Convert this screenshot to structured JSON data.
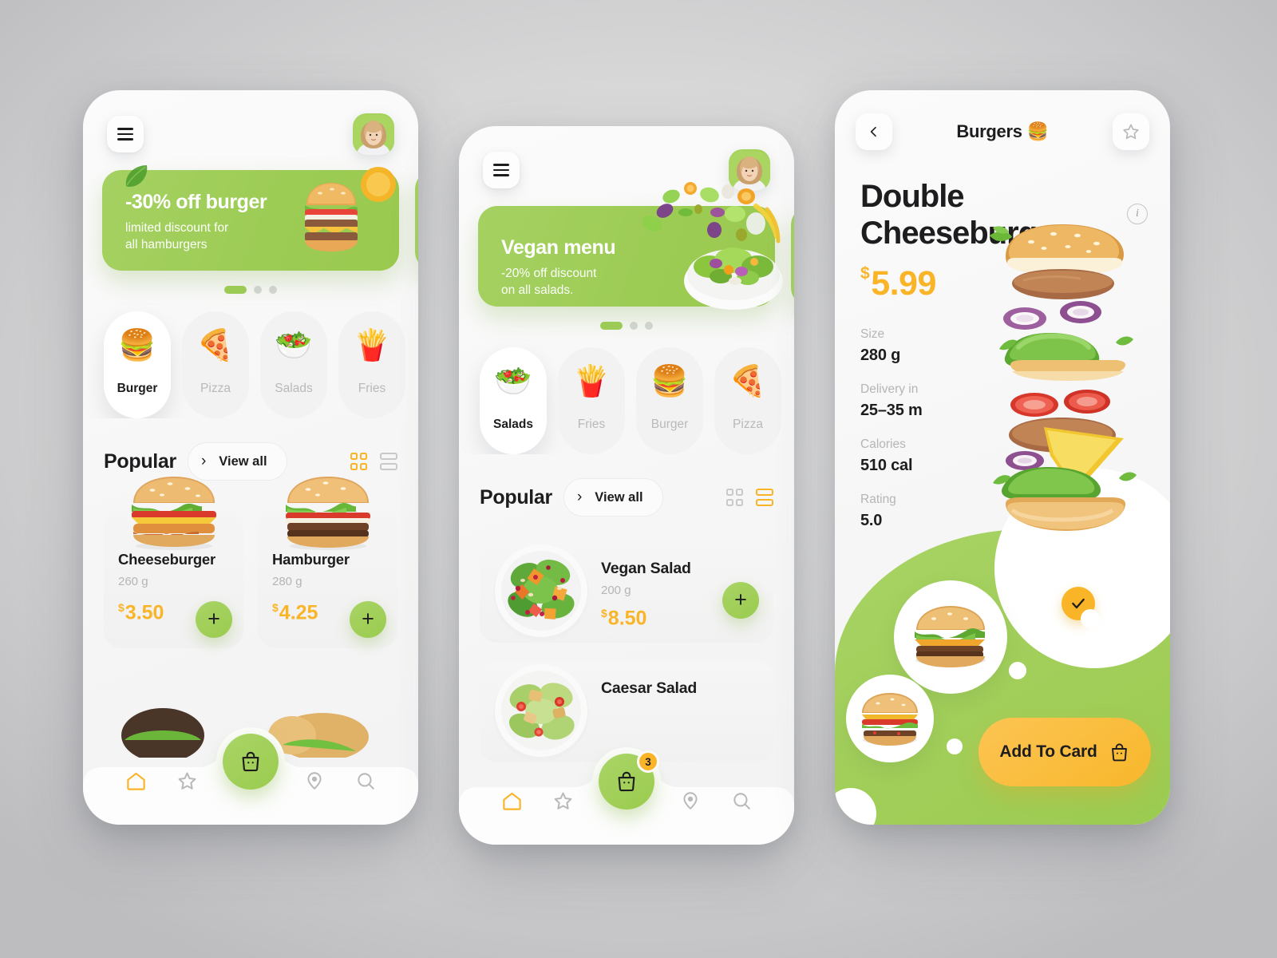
{
  "theme": {
    "green": "#9ACB51",
    "yellow": "#F9B428",
    "dark": "#1D1D1F",
    "muted": "#B5B5B7",
    "card_bg": "#F2F2F2"
  },
  "phone1": {
    "menu_icon": "hamburger-menu-icon",
    "avatar_alt": "user-avatar",
    "banner": {
      "title": "-30% off burger",
      "subtitle_line1": "limited discount for",
      "subtitle_line2": "all hamburgers",
      "art": "burger-photo"
    },
    "carousel": {
      "total": 3,
      "active": 1
    },
    "categories": [
      {
        "label": "Burger",
        "emoji": "🍔",
        "active": true
      },
      {
        "label": "Pizza",
        "emoji": "🍕",
        "active": false
      },
      {
        "label": "Salads",
        "emoji": "🥗",
        "active": false
      },
      {
        "label": "Fries",
        "emoji": "🍟",
        "active": false
      }
    ],
    "section": {
      "title": "Popular",
      "view_all": "View all",
      "chevron": "›",
      "grid_active": true,
      "list_active": false
    },
    "products": [
      {
        "name": "Cheeseburger",
        "weight": "260 g",
        "currency": "$",
        "price": "3.50",
        "add": "+"
      },
      {
        "name": "Hamburger",
        "weight": "280 g",
        "currency": "$",
        "price": "4.25",
        "add": "+"
      }
    ],
    "nav": {
      "items": [
        "home-icon",
        "star-icon",
        "location-pin-icon",
        "search-icon"
      ],
      "active": "home-icon",
      "cart_icon": "shopping-bag-icon",
      "cart_badge": ""
    }
  },
  "phone2": {
    "menu_icon": "hamburger-menu-icon",
    "avatar_alt": "user-avatar",
    "banner": {
      "title": "Vegan menu",
      "subtitle_line1": "-20% off discount",
      "subtitle_line2": "on all salads.",
      "art": "salad-photo"
    },
    "carousel": {
      "total": 3,
      "active": 1
    },
    "categories": [
      {
        "label": "Salads",
        "emoji": "🥗",
        "active": true
      },
      {
        "label": "Fries",
        "emoji": "🍟",
        "active": false
      },
      {
        "label": "Burger",
        "emoji": "🍔",
        "active": false
      },
      {
        "label": "Pizza",
        "emoji": "🍕",
        "active": false
      }
    ],
    "section": {
      "title": "Popular",
      "view_all": "View all",
      "chevron": "›",
      "grid_active": false,
      "list_active": true
    },
    "products": [
      {
        "name": "Vegan Salad",
        "weight": "200 g",
        "currency": "$",
        "price": "8.50",
        "add": "+"
      },
      {
        "name": "Caesar Salad",
        "weight": "",
        "currency": "",
        "price": "",
        "add": "+"
      }
    ],
    "nav": {
      "items": [
        "home-icon",
        "star-icon",
        "location-pin-icon",
        "search-icon"
      ],
      "active": "home-icon",
      "cart_icon": "shopping-bag-icon",
      "cart_badge": "3"
    }
  },
  "phone3": {
    "back_icon": "chevron-left-icon",
    "header_title": "Burgers 🍔",
    "favorite_icon": "star-outline-icon",
    "info_icon": "info-icon",
    "product_title": "Double Cheeseburger",
    "currency": "$",
    "price": "5.99",
    "specs": [
      {
        "key": "Size",
        "value": "280 g"
      },
      {
        "key": "Delivery in",
        "value": "25–35 m"
      },
      {
        "key": "Calories",
        "value": "510 cal"
      },
      {
        "key": "Rating",
        "value": "5.0"
      }
    ],
    "selected_check": "check-icon",
    "cta_label": "Add To Card",
    "cta_icon": "shopping-bag-icon",
    "variants": [
      "burger-variant-1",
      "burger-variant-2"
    ]
  }
}
